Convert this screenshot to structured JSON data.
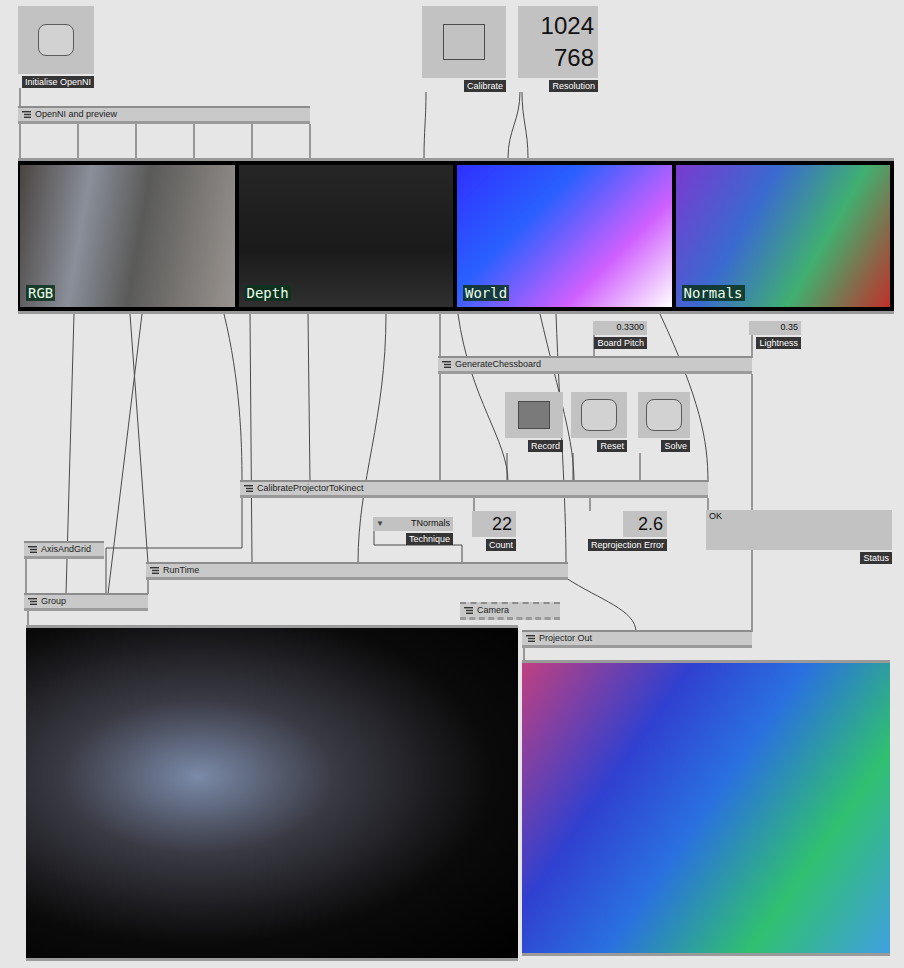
{
  "ioboxes": [
    {
      "kind": "bang",
      "label": "Initialise OpenNI",
      "on": false,
      "values": []
    },
    {
      "kind": "toggle",
      "label": "Calibrate",
      "on": false,
      "values": []
    },
    {
      "kind": "value",
      "label": "Resolution",
      "on": false,
      "values": [
        "1024",
        "768"
      ]
    },
    {
      "kind": "value",
      "label": "Board Pitch",
      "on": false,
      "values": [
        "0.3300"
      ]
    },
    {
      "kind": "value",
      "label": "Lightness",
      "on": false,
      "values": [
        "0.35"
      ]
    },
    {
      "kind": "toggle",
      "label": "Record",
      "on": true,
      "values": []
    },
    {
      "kind": "bang",
      "label": "Reset",
      "on": false,
      "values": []
    },
    {
      "kind": "bang",
      "label": "Solve",
      "on": false,
      "values": []
    },
    {
      "kind": "enum",
      "label": "Technique",
      "on": false,
      "values": [
        "TNormals"
      ],
      "arrow": "▼"
    },
    {
      "kind": "value",
      "label": "Count",
      "on": false,
      "values": [
        "22"
      ]
    },
    {
      "kind": "value",
      "label": "Reprojection Error",
      "on": false,
      "values": [
        "2.6"
      ]
    },
    {
      "kind": "string",
      "label": "Status",
      "on": false,
      "values": [
        "OK"
      ]
    }
  ],
  "nodes": [
    {
      "label": "OpenNI and preview",
      "dashed": false
    },
    {
      "label": "GenerateChessboard",
      "dashed": false
    },
    {
      "label": "CalibrateProjectorToKinect",
      "dashed": false
    },
    {
      "label": "AxisAndGrid",
      "dashed": false
    },
    {
      "label": "RunTime",
      "dashed": false
    },
    {
      "label": "Group",
      "dashed": false
    },
    {
      "label": "Camera",
      "dashed": true
    },
    {
      "label": "Projector Out",
      "dashed": false
    }
  ],
  "preview": {
    "views": [
      {
        "label": "RGB"
      },
      {
        "label": "Depth"
      },
      {
        "label": "World"
      },
      {
        "label": "Normals"
      }
    ]
  }
}
